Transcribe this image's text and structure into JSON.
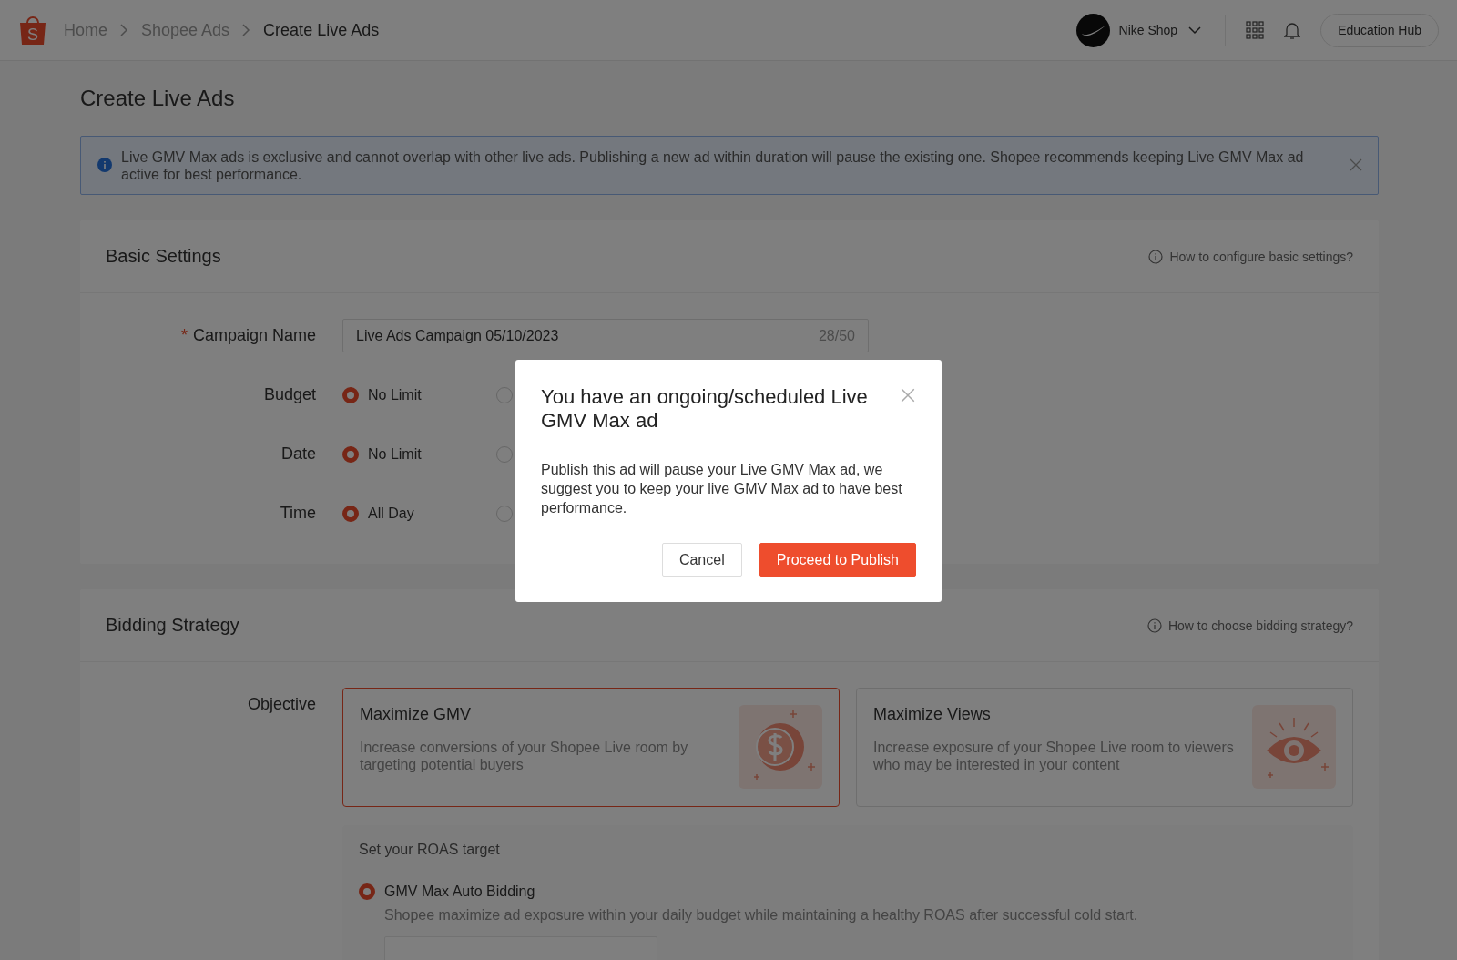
{
  "header": {
    "logo_letter": "S",
    "breadcrumb": [
      {
        "label": "Home",
        "current": false
      },
      {
        "label": "Shopee Ads",
        "current": false
      },
      {
        "label": "Create Live Ads",
        "current": true
      }
    ],
    "shop_name": "Nike Shop",
    "education_hub": "Education Hub"
  },
  "page_title": "Create Live Ads",
  "alert": {
    "text": "Live GMV Max ads is exclusive and cannot overlap with other live ads. Publishing a new ad within duration will pause the existing one. Shopee recommends keeping Live GMV Max ad active for best performance."
  },
  "basic_settings": {
    "title": "Basic Settings",
    "help": "How to configure basic settings?",
    "campaign_name": {
      "label": "Campaign Name",
      "required_mark": "*",
      "value": "Live Ads Campaign 05/10/2023",
      "counter": "28/50"
    },
    "rows": [
      {
        "label": "Budget",
        "options": [
          {
            "label": "No Limit",
            "selected": true
          },
          {
            "selected": false
          }
        ]
      },
      {
        "label": "Date",
        "options": [
          {
            "label": "No Limit",
            "selected": true
          },
          {
            "selected": false
          }
        ]
      },
      {
        "label": "Time",
        "options": [
          {
            "label": "All Day",
            "selected": true
          },
          {
            "selected": false
          }
        ]
      }
    ]
  },
  "bidding_strategy": {
    "title": "Bidding Strategy",
    "help": "How to choose bidding strategy?",
    "objective_label": "Objective",
    "objectives": [
      {
        "kind": "coin",
        "title": "Maximize GMV",
        "description": "Increase conversions of your Shopee Live room by targeting potential buyers",
        "selected": true
      },
      {
        "kind": "eye",
        "title": "Maximize Views",
        "description": "Increase exposure of your Shopee Live room to viewers who may be interested in your content",
        "selected": false
      }
    ],
    "roas": {
      "title": "Set your ROAS target",
      "options": [
        {
          "label": "GMV Max Auto Bidding",
          "description": "Shopee maximize ad exposure within your daily budget while maintaining a healthy ROAS after successful cold start.",
          "selected": true
        }
      ]
    }
  },
  "dialog": {
    "title": "You have an ongoing/scheduled Live GMV Max ad",
    "body": "Publish this ad will pause your Live GMV Max ad, we suggest you to keep your live GMV Max ad to have best performance.",
    "buttons": [
      {
        "kind": "secondary",
        "label": "Cancel"
      },
      {
        "kind": "primary",
        "label": "Proceed to Publish"
      }
    ]
  }
}
